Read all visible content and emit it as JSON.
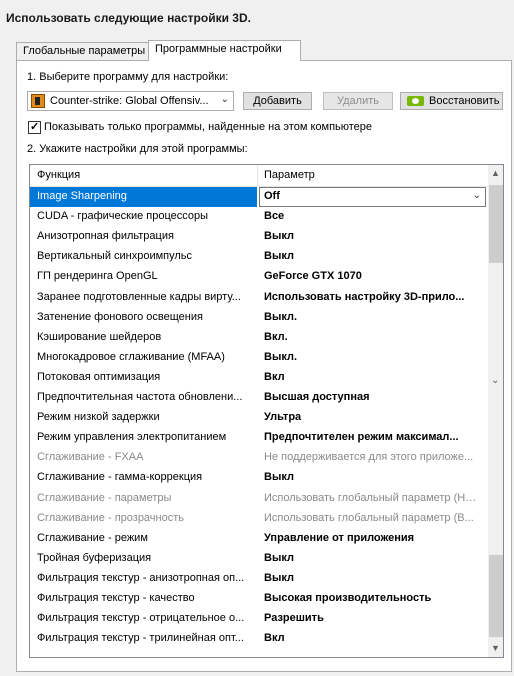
{
  "header": {
    "title": "Использовать следующие настройки 3D."
  },
  "tabs": [
    {
      "label": "Глобальные параметры"
    },
    {
      "label": "Программные настройки"
    }
  ],
  "step1": {
    "label": "1. Выберите программу для настройки:",
    "program": "Counter-strike: Global Offensiv...",
    "add_button": "Добавить",
    "remove_button": "Удалить",
    "restore_button": "Восстановить"
  },
  "filter": {
    "checked": true,
    "label": "Показывать только программы, найденные на этом компьютере"
  },
  "step2": {
    "label": "2. Укажите настройки для этой программы:"
  },
  "grid": {
    "col_function": "Функция",
    "col_param": "Параметр",
    "rows": [
      {
        "fn": "Image Sharpening",
        "pv": "Off"
      },
      {
        "fn": "CUDA - графические процессоры",
        "pv": "Все"
      },
      {
        "fn": "Анизотропная фильтрация",
        "pv": "Выкл"
      },
      {
        "fn": "Вертикальный синхроимпульс",
        "pv": "Выкл"
      },
      {
        "fn": "ГП рендеринга OpenGL",
        "pv": "GeForce GTX 1070"
      },
      {
        "fn": "Заранее подготовленные кадры вирту...",
        "pv": "Использовать настройку 3D-прило..."
      },
      {
        "fn": "Затенение фонового освещения",
        "pv": "Выкл."
      },
      {
        "fn": "Кэширование шейдеров",
        "pv": "Вкл."
      },
      {
        "fn": "Многокадровое сглаживание (MFAA)",
        "pv": "Выкл."
      },
      {
        "fn": "Потоковая оптимизация",
        "pv": "Вкл"
      },
      {
        "fn": "Предпочтительная частота обновлени...",
        "pv": "Высшая доступная"
      },
      {
        "fn": "Режим низкой задержки",
        "pv": "Ультра"
      },
      {
        "fn": "Режим управления электропитанием",
        "pv": "Предпочтителен режим максимал..."
      },
      {
        "fn": "Сглаживание - FXAA",
        "pv": "Не поддерживается для этого приложе..."
      },
      {
        "fn": "Сглаживание - гамма-коррекция",
        "pv": "Выкл"
      },
      {
        "fn": "Сглаживание - параметры",
        "pv": "Использовать глобальный параметр (Нет)"
      },
      {
        "fn": "Сглаживание - прозрачность",
        "pv": "Использовать глобальный параметр (В..."
      },
      {
        "fn": "Сглаживание - режим",
        "pv": "Управление от приложения"
      },
      {
        "fn": "Тройная буферизация",
        "pv": "Выкл"
      },
      {
        "fn": "Фильтрация текстур - анизотропная оп...",
        "pv": "Выкл"
      },
      {
        "fn": "Фильтрация текстур - качество",
        "pv": "Высокая производительность"
      },
      {
        "fn": "Фильтрация текстур - отрицательное о...",
        "pv": "Разрешить"
      },
      {
        "fn": "Фильтрация текстур - трилинейная опт...",
        "pv": "Вкл"
      }
    ]
  },
  "colors": {
    "selection": "#0078d7",
    "nvidia_green": "#76b900"
  },
  "icons": [
    "counter-strike-icon",
    "nvidia-icon",
    "chevron-down-icon",
    "scroll-up-icon",
    "scroll-down-icon"
  ]
}
